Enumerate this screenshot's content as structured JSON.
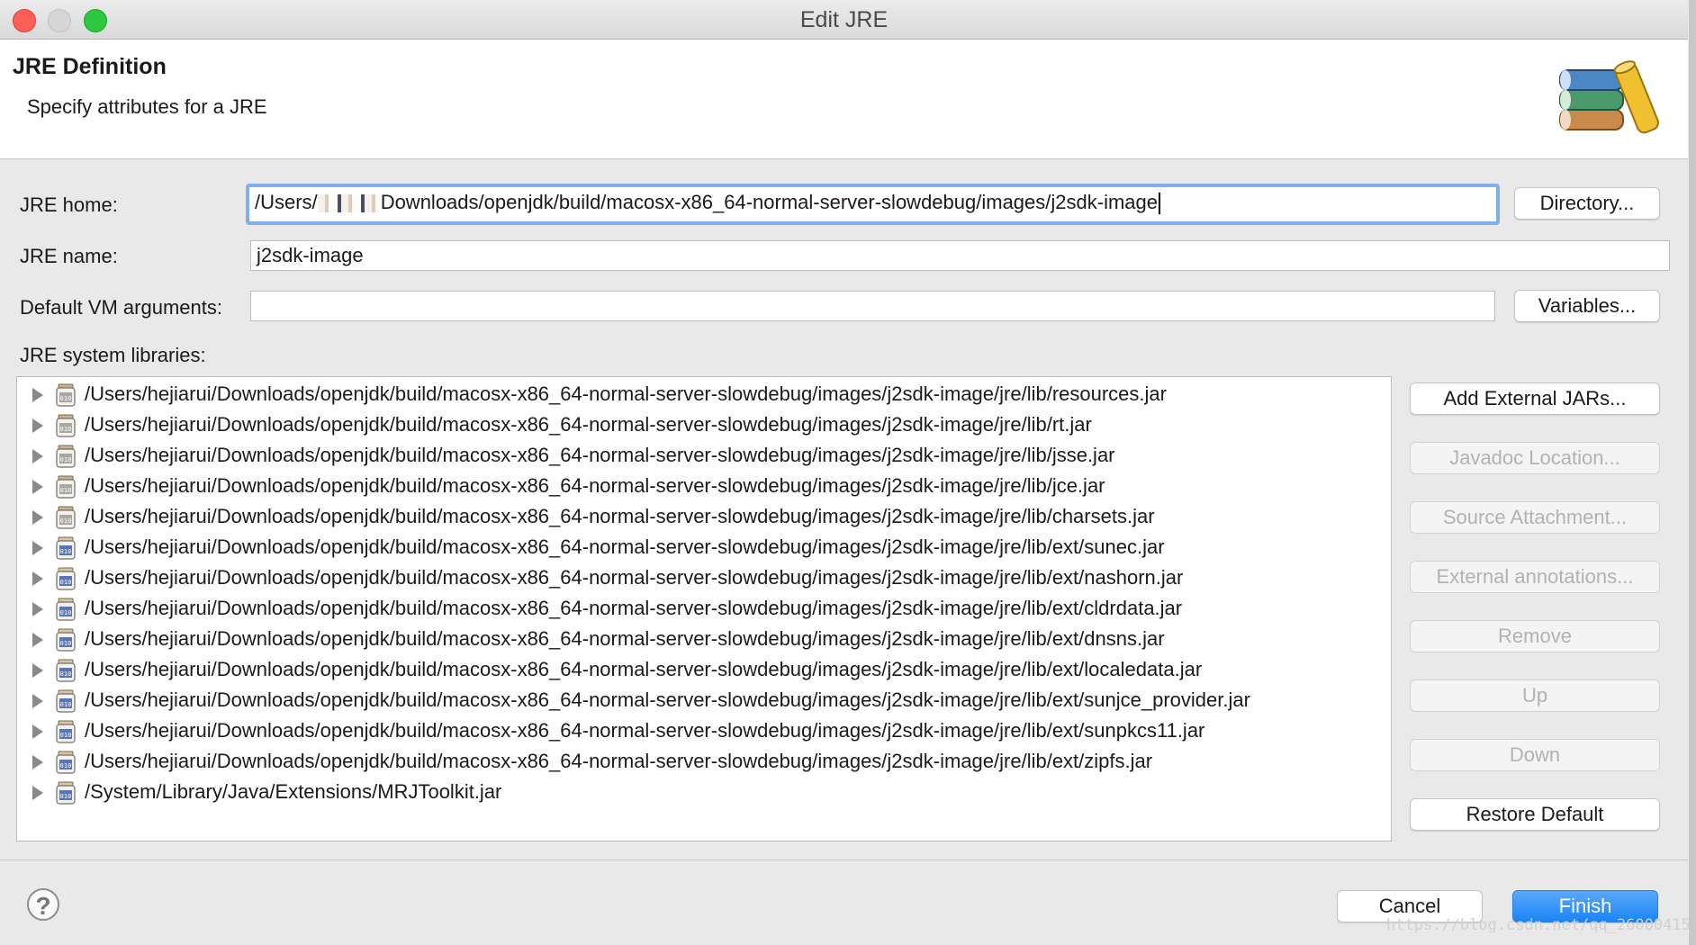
{
  "window": {
    "title": "Edit JRE"
  },
  "header": {
    "title": "JRE Definition",
    "subtitle": "Specify attributes for a JRE"
  },
  "form": {
    "jre_home_label": "JRE home:",
    "jre_home_prefix": "/Users/",
    "jre_home_suffix": "Downloads/openjdk/build/macosx-x86_64-normal-server-slowdebug/images/j2sdk-image",
    "directory_button": "Directory...",
    "jre_name_label": "JRE name:",
    "jre_name_value": "j2sdk-image",
    "vm_args_label": "Default VM arguments:",
    "vm_args_value": "",
    "variables_button": "Variables...",
    "libraries_label": "JRE system libraries:"
  },
  "libraries": [
    {
      "path": "/Users/hejiarui/Downloads/openjdk/build/macosx-x86_64-normal-server-slowdebug/images/j2sdk-image/jre/lib/resources.jar",
      "icon": "jar-library-icon"
    },
    {
      "path": "/Users/hejiarui/Downloads/openjdk/build/macosx-x86_64-normal-server-slowdebug/images/j2sdk-image/jre/lib/rt.jar",
      "icon": "jar-library-icon"
    },
    {
      "path": "/Users/hejiarui/Downloads/openjdk/build/macosx-x86_64-normal-server-slowdebug/images/j2sdk-image/jre/lib/jsse.jar",
      "icon": "jar-library-icon"
    },
    {
      "path": "/Users/hejiarui/Downloads/openjdk/build/macosx-x86_64-normal-server-slowdebug/images/j2sdk-image/jre/lib/jce.jar",
      "icon": "jar-library-icon"
    },
    {
      "path": "/Users/hejiarui/Downloads/openjdk/build/macosx-x86_64-normal-server-slowdebug/images/j2sdk-image/jre/lib/charsets.jar",
      "icon": "jar-library-icon"
    },
    {
      "path": "/Users/hejiarui/Downloads/openjdk/build/macosx-x86_64-normal-server-slowdebug/images/j2sdk-image/jre/lib/ext/sunec.jar",
      "icon": "jar-ext-icon"
    },
    {
      "path": "/Users/hejiarui/Downloads/openjdk/build/macosx-x86_64-normal-server-slowdebug/images/j2sdk-image/jre/lib/ext/nashorn.jar",
      "icon": "jar-ext-icon"
    },
    {
      "path": "/Users/hejiarui/Downloads/openjdk/build/macosx-x86_64-normal-server-slowdebug/images/j2sdk-image/jre/lib/ext/cldrdata.jar",
      "icon": "jar-ext-icon"
    },
    {
      "path": "/Users/hejiarui/Downloads/openjdk/build/macosx-x86_64-normal-server-slowdebug/images/j2sdk-image/jre/lib/ext/dnsns.jar",
      "icon": "jar-ext-icon"
    },
    {
      "path": "/Users/hejiarui/Downloads/openjdk/build/macosx-x86_64-normal-server-slowdebug/images/j2sdk-image/jre/lib/ext/localedata.jar",
      "icon": "jar-ext-icon"
    },
    {
      "path": "/Users/hejiarui/Downloads/openjdk/build/macosx-x86_64-normal-server-slowdebug/images/j2sdk-image/jre/lib/ext/sunjce_provider.jar",
      "icon": "jar-ext-icon"
    },
    {
      "path": "/Users/hejiarui/Downloads/openjdk/build/macosx-x86_64-normal-server-slowdebug/images/j2sdk-image/jre/lib/ext/sunpkcs11.jar",
      "icon": "jar-ext-icon"
    },
    {
      "path": "/Users/hejiarui/Downloads/openjdk/build/macosx-x86_64-normal-server-slowdebug/images/j2sdk-image/jre/lib/ext/zipfs.jar",
      "icon": "jar-ext-icon"
    },
    {
      "path": "/System/Library/Java/Extensions/MRJToolkit.jar",
      "icon": "jar-ext-icon"
    }
  ],
  "side_buttons": {
    "add_external_jars": "Add External JARs...",
    "javadoc_location": "Javadoc Location...",
    "source_attachment": "Source Attachment...",
    "external_annotations": "External annotations...",
    "remove": "Remove",
    "up": "Up",
    "down": "Down",
    "restore_default": "Restore Default"
  },
  "footer": {
    "cancel": "Cancel",
    "finish": "Finish",
    "help_glyph": "?"
  },
  "watermark": "https://blog.csdn.net/qq_26000415"
}
